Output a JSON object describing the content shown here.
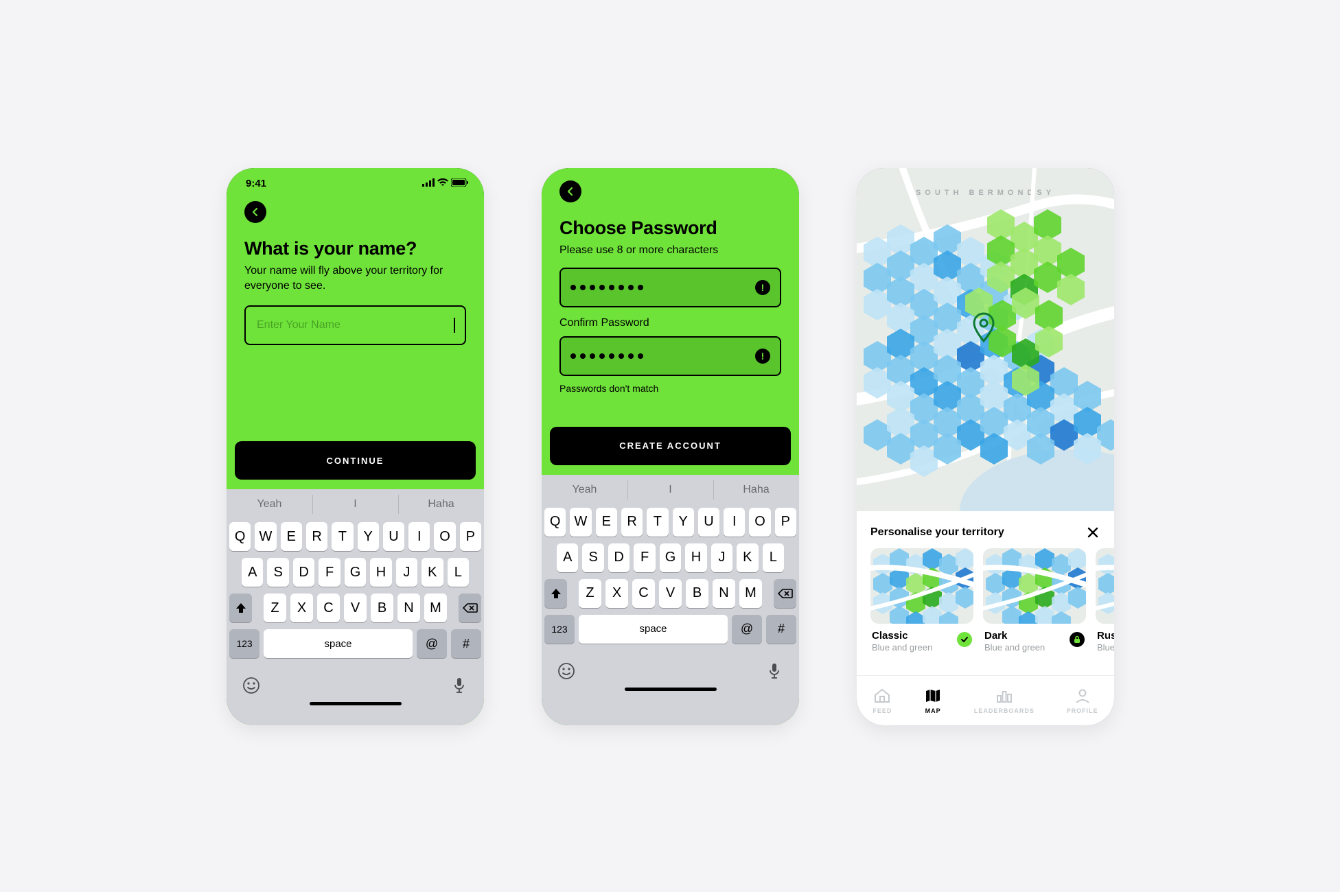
{
  "screen1": {
    "status_time": "9:41",
    "title": "What is your name?",
    "subtitle": "Your name will fly above your territory for everyone to see.",
    "name_placeholder": "Enter Your Name",
    "cta": "CONTINUE"
  },
  "screen2": {
    "title": "Choose Password",
    "subtitle": "Please use 8 or more characters",
    "confirm_label": "Confirm Password",
    "error": "Passwords don't match",
    "cta": "CREATE ACCOUNT",
    "password_dot_count": 8,
    "confirm_dot_count": 8
  },
  "screen3": {
    "district": "SOUTH BERMONDSY",
    "sheet_title": "Personalise your territory",
    "themes": [
      {
        "name": "Classic",
        "desc": "Blue and green",
        "state": "selected"
      },
      {
        "name": "Dark",
        "desc": "Blue and green",
        "state": "locked"
      },
      {
        "name": "Rust",
        "desc": "Blue a",
        "state": "none"
      }
    ],
    "tabs": [
      {
        "label": "FEED"
      },
      {
        "label": "MAP"
      },
      {
        "label": "LEADERBOARDS"
      },
      {
        "label": "PROFILE"
      }
    ],
    "active_tab": "MAP"
  },
  "keyboard": {
    "suggestions": [
      "Yeah",
      "I",
      "Haha"
    ],
    "row1": [
      "Q",
      "W",
      "E",
      "R",
      "T",
      "Y",
      "U",
      "I",
      "O",
      "P"
    ],
    "row2": [
      "A",
      "S",
      "D",
      "F",
      "G",
      "H",
      "J",
      "K",
      "L"
    ],
    "row3": [
      "Z",
      "X",
      "C",
      "V",
      "B",
      "N",
      "M"
    ],
    "num_label": "123",
    "space_label": "space",
    "at_label": "@",
    "hash_label": "#"
  }
}
